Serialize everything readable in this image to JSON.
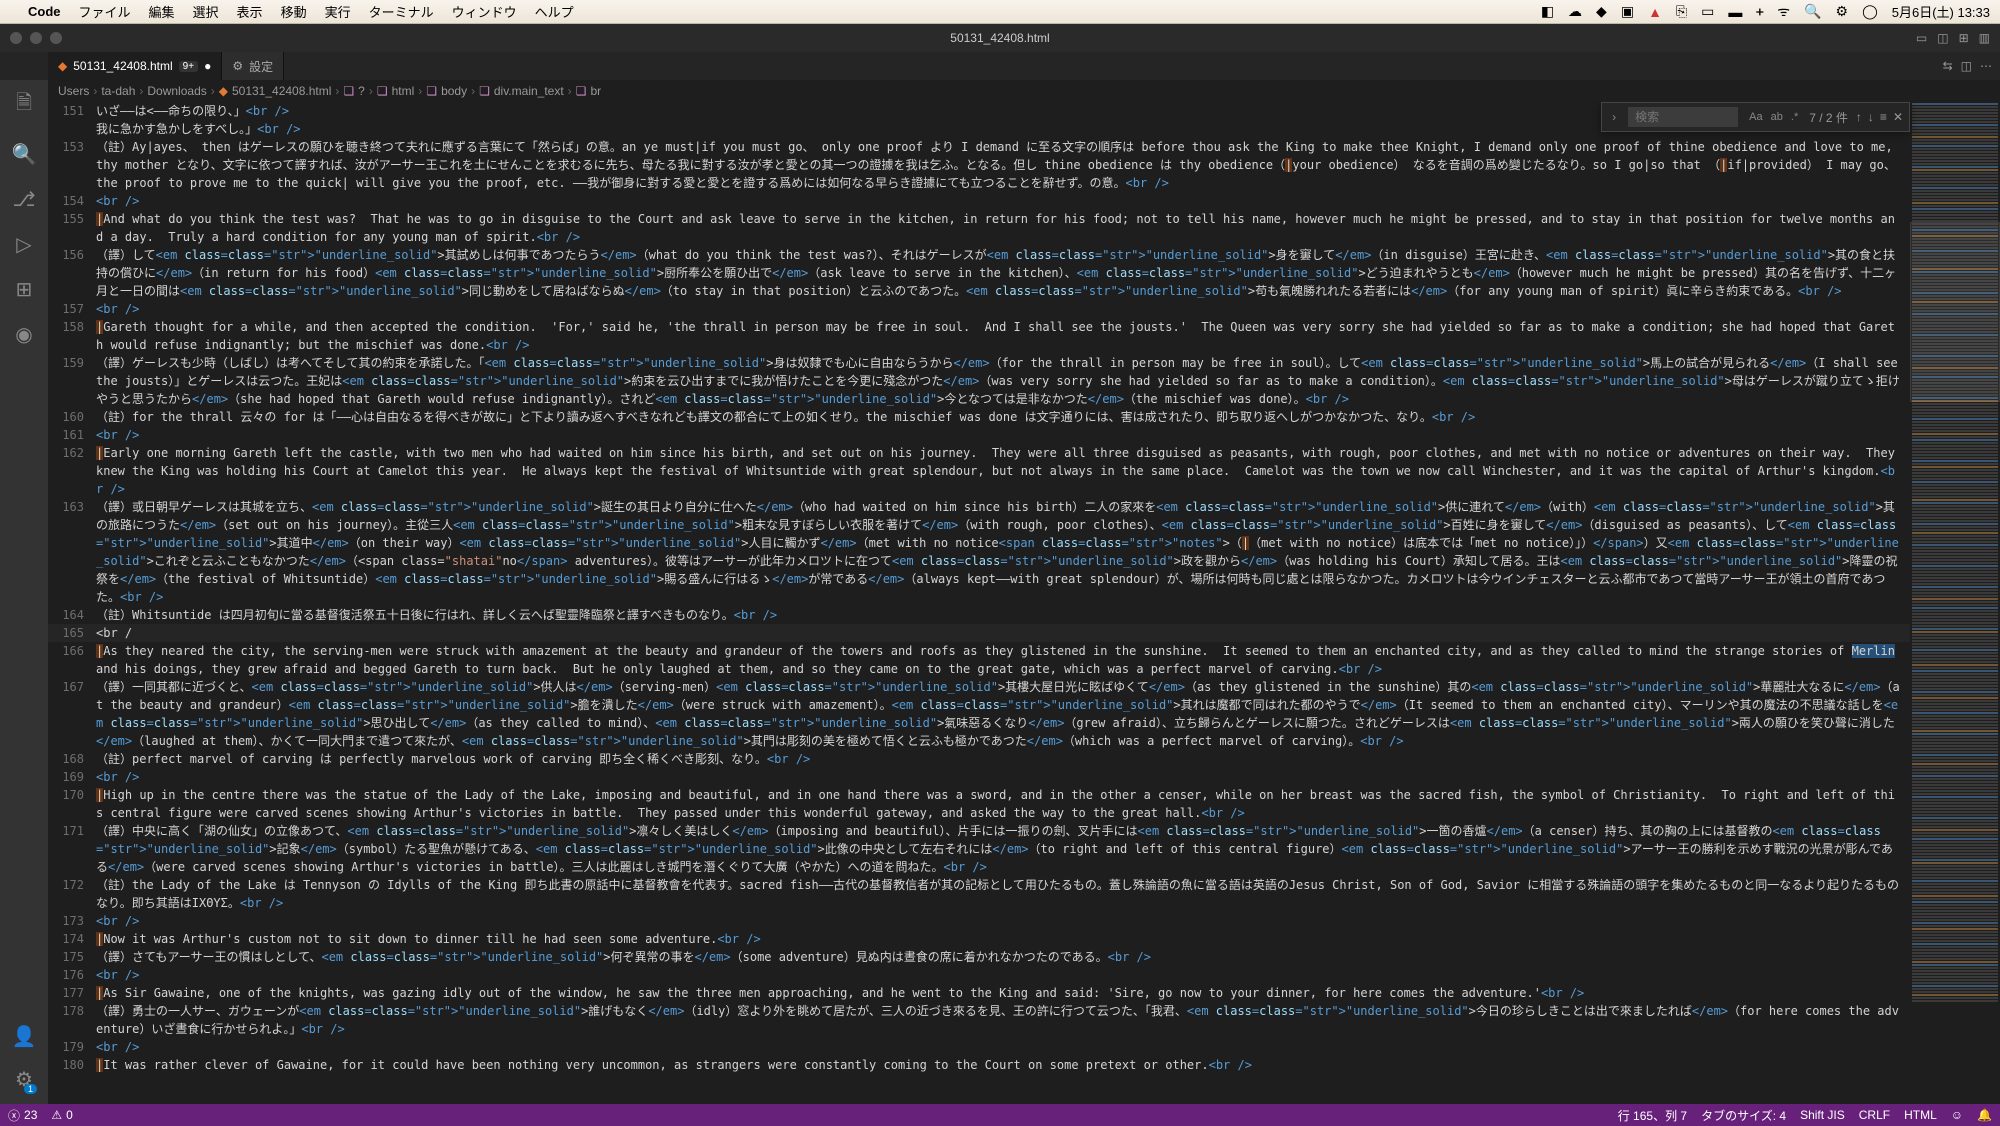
{
  "menubar": {
    "app": "Code",
    "items": [
      "ファイル",
      "編集",
      "選択",
      "表示",
      "移動",
      "実行",
      "ターミナル",
      "ウィンドウ",
      "ヘルプ"
    ],
    "clock": "5月6日(土) 13:33"
  },
  "window": {
    "title": "50131_42408.html",
    "tab_active": "50131_42408.html",
    "tab_mod": "9+",
    "tab_settings": "設定"
  },
  "breadcrumbs": [
    "Users",
    "ta-dah",
    "Downloads",
    "50131_42408.html",
    "?",
    "html",
    "body",
    "div.main_text",
    "br"
  ],
  "find": {
    "placeholder": "検索",
    "count": "7 / 2 件"
  },
  "status": {
    "errors": "23",
    "warnings": "0",
    "pos": "行 165、列 7",
    "tabsize": "タブのサイズ: 4",
    "encoding": "Shift JIS",
    "eol": "CRLF",
    "lang": "HTML"
  },
  "lines": [
    {
      "n": "151",
      "c": "いざ――は<――命ちの限り、」<br />"
    },
    {
      "n": "",
      "c": "我に急かす急かしをすべし。」<br />"
    },
    {
      "n": "153",
      "c": "（註）Ay|ayes、 then はゲーレスの願ひを聴き終つて夫れに應ずる言葉にて「然らば」の意。an ye must|if you must go、 only one proof より I demand に至る文字の順序は before thou ask the King to make thee Knight, I demand only one proof of thine obedience and love to me, thy mother となり、文字に依つて譯すれば、汝がアーサー王これを土にせんことを求むるに先ち、母たる我に對する汝が孝と愛との其一つの證據を我は乞ふ。となる。但し thine obedience は thy obedience（|your obedience） なるを音調の爲め變じたるなり。so I go|so that （|if|provided） I may go、 the proof to prove me to the quick| will give you the proof, etc. ――我が御身に對する愛と愛とを證する爲めには如何なる早らき證據にても立つることを辭せず。の意。<br />"
    },
    {
      "n": "154",
      "c": "<br />"
    },
    {
      "n": "155",
      "c": "|And what do you think the test was?  That he was to go in disguise to the Court and ask leave to serve in the kitchen, in return for his food; not to tell his name, however much he might be pressed, and to stay in that position for twelve months and a day.  Truly a hard condition for any young man of spirit.<br />"
    },
    {
      "n": "156",
      "c": "（譯）して<em class=\"underline_solid\">其試めしは何事であつたらう</em>（what do you think the test was?）、それはゲーレスが<em class=\"underline_solid\">身を窶して</em>（in disguise）王宮に赴き、<em class=\"underline_solid\">其の食と扶持の償ひに</em>（in return for his food）<em class=\"underline_solid\">厨所奉公を願ひ出で</em>（ask leave to serve in the kitchen）、<em class=\"underline_solid\">どう迫まれやうとも</em>（however much he might be pressed）其の名を告げず、十二ヶ月と一日の間は<em class=\"underline_solid\">同じ動めをして居ねばならぬ</em>（to stay in that position）と云ふのであつた。<em class=\"underline_solid\">苟も氣魄勝れれたる若者には</em>（for any young man of spirit）眞に辛らき約束である。<br />"
    },
    {
      "n": "157",
      "c": "<br />"
    },
    {
      "n": "158",
      "c": "|Gareth thought for a while, and then accepted the condition.  'For,' said he, 'the thrall in person may be free in soul.  And I shall see the jousts.'  The Queen was very sorry she had yielded so far as to make a condition; she had hoped that Gareth would refuse indignantly; but the mischief was done.<br />"
    },
    {
      "n": "159",
      "c": "（譯）ゲーレスも少時（しばし）は考へてそして其の約束を承諾した。「<em class=\"underline_solid\">身は奴隸でも心に自由ならうから</em>（for the thrall in person may be free in soul）。して<em class=\"underline_solid\">馬上の試合が見られる</em>（I shall see the jousts）」とゲーレスは云つた。王妃は<em class=\"underline_solid\">約束を云ひ出すまでに我が悟けたことを今更に殘念がつた</em>（was very sorry she had yielded so far as to make a condition）。<em class=\"underline_solid\">母はゲーレスが蹴り立てゝ拒けやうと思うたから</em>（she had hoped that Gareth would refuse indignantly）。されど<em class=\"underline_solid\">今となつては是非なかつた</em>（the mischief was done）。<br />"
    },
    {
      "n": "160",
      "c": "（註）for the thrall 云々の for は「――心は自由なるを得べきが故に」と下より讀み返へすべきなれども譯文の都合にて上の如くせり。the mischief was done は文字通りには、害は成されたり、即ち取り返へしがつかなかつた、なり。<br />"
    },
    {
      "n": "161",
      "c": "<br />"
    },
    {
      "n": "162",
      "c": "|Early one morning Gareth left the castle, with two men who had waited on him since his birth, and set out on his journey.  They were all three disguised as peasants, with rough, poor clothes, and met with no notice or adventures on their way.  They knew the King was holding his Court at Camelot this year.  He always kept the festival of Whitsuntide with great splendour, but not always in the same place.  Camelot was the town we now call Winchester, and it was the capital of Arthur's kingdom.<br />"
    },
    {
      "n": "163",
      "c": "（譯）或日朝早ゲーレスは其城を立ち、<em class=\"underline_solid\">誕生の其日より自分に仕へた</em>（who had waited on him since his birth）二人の家來を<em class=\"underline_solid\">供に連れて</em>（with）<em class=\"underline_solid\">其の旅路につうた</em>（set out on his journey）。主從三人<em class=\"underline_solid\">粗末な見すぼらしい衣服を著けて</em>（with rough, poor clothes）、<em class=\"underline_solid\">百姓に身を窶して</em>（disguised as peasants）、して<em class=\"underline_solid\">其道中</em>（on their way）<em class=\"underline_solid\">人目に觸かず</em>（met with no notice<span class=\"notes\">（|（met with no notice）は底本では「met no notice）」）</span>）又<em class=\"underline_solid\">これぞと云ふこともなかつた</em>（<span class=\"shatai\"no</span> adventures）。彼等はアーサーが此年カメロツトに在つて<em class=\"underline_solid\">政を觀から</em>（was holding his Court）承知して居る。王は<em class=\"underline_solid\">降靈の祝祭を</em>（the festival of Whitsuntide）<em class=\"underline_solid\">賜る盛んに行はるゝ</em>が常である</em>（always kept――with great splendour）が、場所は何時も同じ處とは限らなかつた。カメロツトは今ウインチェスターと云ふ都市であつて當時アーサー王が領土の首府であつた。<br />"
    },
    {
      "n": "164",
      "c": "（註）Whitsuntide は四月初旬に當る基督復活祭五十日後に行はれ、詳しく云へば聖靈降臨祭と譯すべきものなり。<br />"
    },
    {
      "n": "165",
      "c": "<br /"
    },
    {
      "n": "166",
      "c": "|As they neared the city, the serving-men were struck with amazement at the beauty and grandeur of the towers and roofs as they glistened in the sunshine.  It seemed to them an enchanted city, and as they called to mind the strange stories of Merlin and his doings, they grew afraid and begged Gareth to turn back.  But he only laughed at them, and so they came on to the great gate, which was a perfect marvel of carving.<br />"
    },
    {
      "n": "167",
      "c": "（譯）一同其都に近づくと、<em class=\"underline_solid\">供人は</em>（serving-men）<em class=\"underline_solid\">其樓大屋日光に眩ばゆくて</em>（as they glistened in the sunshine）其の<em class=\"underline_solid\">華麗壯大なるに</em>（at the beauty and grandeur）<em class=\"underline_solid\">膽を潰した</em>（were struck with amazement）。<em class=\"underline_solid\">其れは魔都で同はれた都のやうで</em>（It seemed to them an enchanted city）、マーリンや其の魔法の不思議な話しを<em class=\"underline_solid\">思ひ出して</em>（as they called to mind）、<em class=\"underline_solid\">氣味惡るくなり</em>（grew afraid）、立ち歸らんとゲーレスに願つた。されどゲーレスは<em class=\"underline_solid\">兩人の願ひを笑ひ聲に消した</em>（laughed at them）、かくて一同大門まで遣つて來たが、<em class=\"underline_solid\">其門は彫刻の美を極めて悟くと云ふも極かであつた</em>（which was a perfect marvel of carving）。<br />"
    },
    {
      "n": "168",
      "c": "（註）perfect marvel of carving は perfectly marvelous work of carving 即ち全く稀くべき彫刻、なり。<br />"
    },
    {
      "n": "169",
      "c": "<br />"
    },
    {
      "n": "170",
      "c": "|High up in the centre there was the statue of the Lady of the Lake, imposing and beautiful, and in one hand there was a sword, and in the other a censer, while on her breast was the sacred fish, the symbol of Christianity.  To right and left of this central figure were carved scenes showing Arthur's victories in battle.  They passed under this wonderful gateway, and asked the way to the great hall.<br />"
    },
    {
      "n": "171",
      "c": "（譯）中央に高く「湖の仙女」の立像あつて、<em class=\"underline_solid\">凛々しく美はしく</em>（imposing and beautiful）、片手には一振りの劍、叉片手には<em class=\"underline_solid\">一箇の香爐</em>（a censer）持ち、其の胸の上には基督教の<em class=\"underline_solid\">記象</em>（symbol）たる聖魚が懸けてある、<em class=\"underline_solid\">此像の中央として左右それには</em>（to right and left of this central figure）<em class=\"underline_solid\">アーサー王の勝利を示めす戰況の光景が彫んである</em>（were carved scenes showing Arthur's victories in battle）。三人は此麗はしき城門を潛くぐりて大廣（やかた）への道を問ねた。<br />"
    },
    {
      "n": "172",
      "c": "（註）the Lady of the Lake は Tennyson の Idylls of the King 即ち此書の原話中に基督教會を代表す。sacred fish――古代の基督教信者が其の記标として用ひたるもの。蓋し殊論語の魚に當る語は英語のJesus Christ, Son of God, Savior に相當する殊論語の頭字を集めたるものと同一なるより起りたるものなり。即ち其語はΙΧΘΥΣ。<br />"
    },
    {
      "n": "173",
      "c": "<br />"
    },
    {
      "n": "174",
      "c": "|Now it was Arthur's custom not to sit down to dinner till he had seen some adventure.<br />"
    },
    {
      "n": "175",
      "c": "（譯）さてもアーサー王の慣はしとして、<em class=\"underline_solid\">何ぞ異常の事を</em>（some adventure）見ぬ内は晝食の席に着かれなかつたのである。<br />"
    },
    {
      "n": "176",
      "c": "<br />"
    },
    {
      "n": "177",
      "c": "|As Sir Gawaine, one of the knights, was gazing idly out of the window, he saw the three men approaching, and he went to the King and said: 'Sire, go now to your dinner, for here comes the adventure.'<br />"
    },
    {
      "n": "178",
      "c": "（譯）勇士の一人サー、ガウェーンが<em class=\"underline_solid\">誰げもなく</em>（idly）窓より外を眺めて居たが、三人の近づき來るを見、王の許に行つて云つた、「我君、<em class=\"underline_solid\">今日の珍らしきことは出で來ましたれば</em>（for here comes the adventure）いざ晝食に行かせられよ。」<br />"
    },
    {
      "n": "179",
      "c": "<br />"
    },
    {
      "n": "180",
      "c": "|It was rather clever of Gawaine, for it could have been nothing very uncommon, as strangers were constantly coming to the Court on some pretext or other.<br />"
    }
  ]
}
